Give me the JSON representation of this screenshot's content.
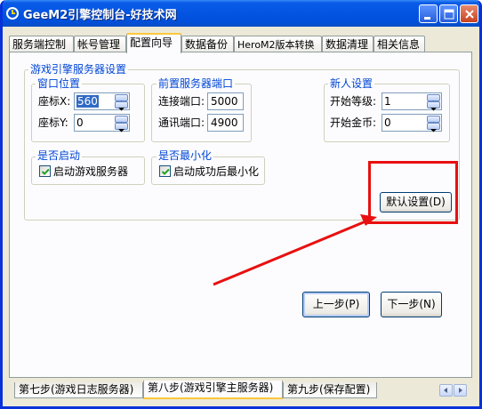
{
  "window": {
    "title": "GeeM2引擎控制台-好技术网"
  },
  "tabs": [
    {
      "label": "服务端控制",
      "active": false
    },
    {
      "label": "帐号管理",
      "active": false
    },
    {
      "label": "配置向导",
      "active": true
    },
    {
      "label": "数据备份",
      "active": false
    },
    {
      "label": "HeroM2版本转换",
      "active": false
    },
    {
      "label": "数据清理",
      "active": false
    },
    {
      "label": "相关信息",
      "active": false
    }
  ],
  "game_engine": {
    "group_title": "游戏引擎服务器设置",
    "window_position": {
      "title": "窗口位置",
      "x_label": "座标X:",
      "x_value": "560",
      "y_label": "座标Y:",
      "y_value": "0"
    },
    "front_server_port": {
      "title": "前置服务器端口",
      "connect_label": "连接端口:",
      "connect_value": "5000",
      "comm_label": "通讯端口:",
      "comm_value": "4900"
    },
    "new_player": {
      "title": "新人设置",
      "level_label": "开始等级:",
      "level_value": "1",
      "gold_label": "开始金币:",
      "gold_value": "0"
    },
    "auto_start": {
      "title": "是否启动",
      "checkbox_label": "启动游戏服务器",
      "checked": true
    },
    "minimize": {
      "title": "是否最小化",
      "checkbox_label": "启动成功后最小化",
      "checked": true
    },
    "default_button_label": "默认设置(D)"
  },
  "nav": {
    "prev_label": "上一步(P)",
    "next_label": "下一步(N)"
  },
  "bottom_tabs": [
    {
      "label": "第七步(游戏日志服务器)",
      "active": false
    },
    {
      "label": "第八步(游戏引擎主服务器)",
      "active": true
    },
    {
      "label": "第九步(保存配置)",
      "active": false
    }
  ],
  "annotation_color": "#e81010",
  "accent_color": "#0046d5"
}
